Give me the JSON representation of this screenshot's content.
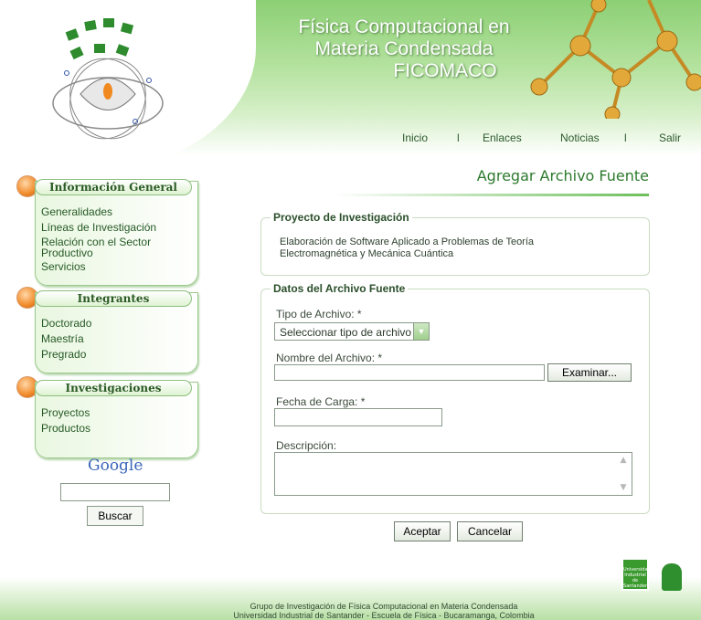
{
  "header": {
    "title_line1": "Física Computacional en",
    "title_line2": "Materia Condensada",
    "title_line3": "FICOMACO",
    "nav": [
      {
        "label": "Inicio"
      },
      {
        "label": "l"
      },
      {
        "label": "Enlaces"
      },
      {
        "label": "Noticias"
      },
      {
        "label": "l"
      },
      {
        "label": "Salir"
      }
    ]
  },
  "sidebar": {
    "sections": [
      {
        "title": "Información General",
        "items": [
          "Generalidades",
          "Líneas de Investigación",
          "Relación con el Sector Productivo",
          "Servicios"
        ]
      },
      {
        "title": "Integrantes",
        "items": [
          "Doctorado",
          "Maestría",
          "Pregrado"
        ]
      },
      {
        "title": "Investigaciones",
        "items": [
          "Proyectos",
          "Productos"
        ]
      }
    ],
    "google_label": "Google",
    "search_button": "Buscar"
  },
  "main": {
    "page_title": "Agregar Archivo Fuente",
    "proyecto": {
      "legend": "Proyecto de Investigación",
      "text": "Elaboración de Software Aplicado a Problemas de Teoría Electromagnética y Mecánica Cuántica"
    },
    "datos": {
      "legend": "Datos del Archivo Fuente",
      "tipo_label": "Tipo de Archivo: *",
      "tipo_value": "Seleccionar tipo de archivo",
      "nombre_label": "Nombre del Archivo: *",
      "examinar": "Examinar...",
      "fecha_label": "Fecha de Carga: *",
      "descripcion_label": "Descripción:"
    },
    "aceptar": "Aceptar",
    "cancelar": "Cancelar"
  },
  "footer": {
    "line1": "Grupo de Investigación de Física Computacional en Materia Condensada",
    "line2": "Universidad Industrial de Santander - Escuela de Física - Bucaramanga, Colombia",
    "uis_badge": "Universidad Industrial de Santander"
  },
  "colors": {
    "accent_green": "#2d7a2d",
    "header_green": "#8ccf74",
    "orb_orange": "#f18b2a"
  }
}
